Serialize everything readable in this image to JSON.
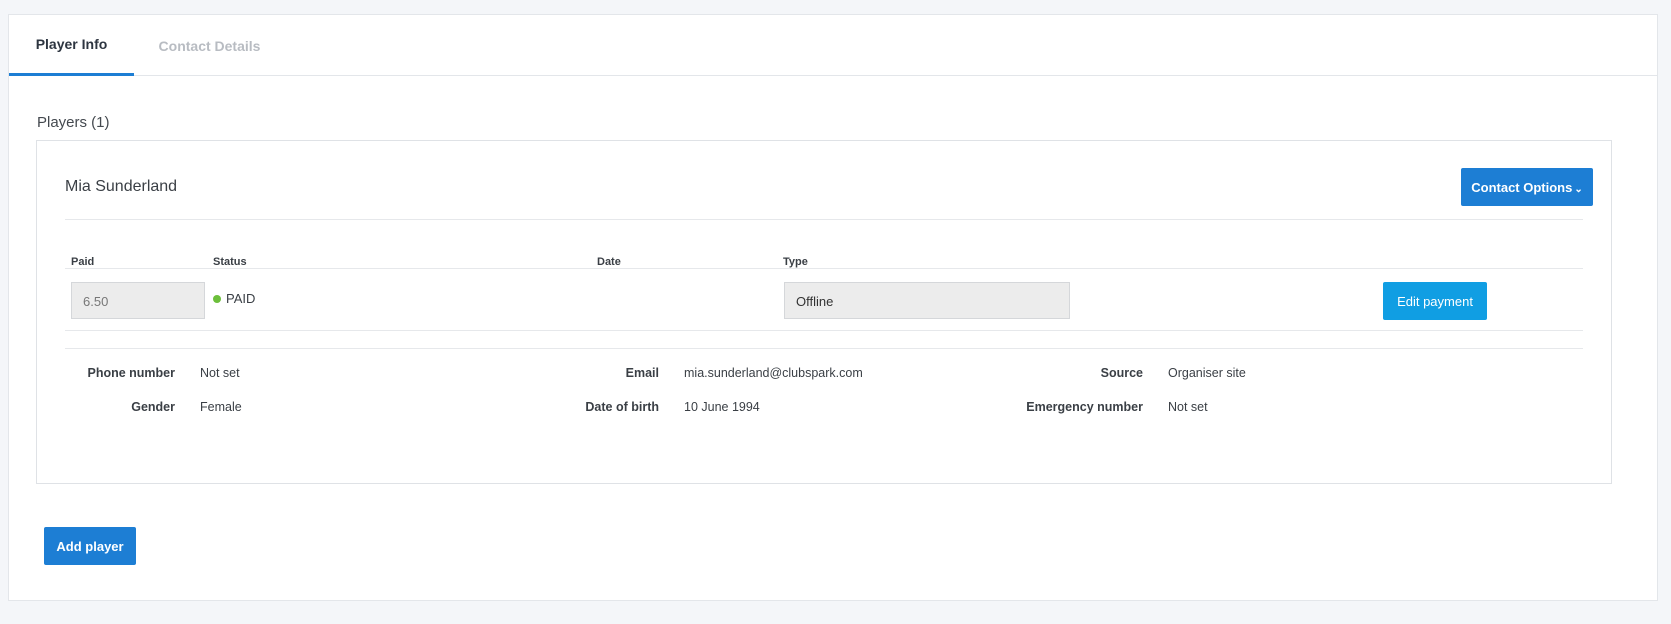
{
  "tabs": [
    {
      "label": "Player Info",
      "active": true
    },
    {
      "label": "Contact Details",
      "active": false
    }
  ],
  "players_heading": "Players (1)",
  "player": {
    "name": "Mia Sunderland",
    "contact_options_label": "Contact Options",
    "table_headers": {
      "paid": "Paid",
      "status": "Status",
      "date": "Date",
      "type": "Type"
    },
    "payment": {
      "paid_value": "6.50",
      "status": "PAID",
      "status_color": "#6cbf3b",
      "date": "",
      "type": "Offline",
      "edit_label": "Edit payment"
    },
    "details": {
      "phone_label": "Phone number",
      "phone_value": "Not set",
      "email_label": "Email",
      "email_value": "mia.sunderland@clubspark.com",
      "source_label": "Source",
      "source_value": "Organiser site",
      "gender_label": "Gender",
      "gender_value": "Female",
      "dob_label": "Date of birth",
      "dob_value": "10 June 1994",
      "emergency_label": "Emergency number",
      "emergency_value": "Not set"
    }
  },
  "add_player_label": "Add player",
  "colors": {
    "primary": "#1d7ed4",
    "edit_button": "#109ee3",
    "tab_underline": "#1d7ed4"
  }
}
